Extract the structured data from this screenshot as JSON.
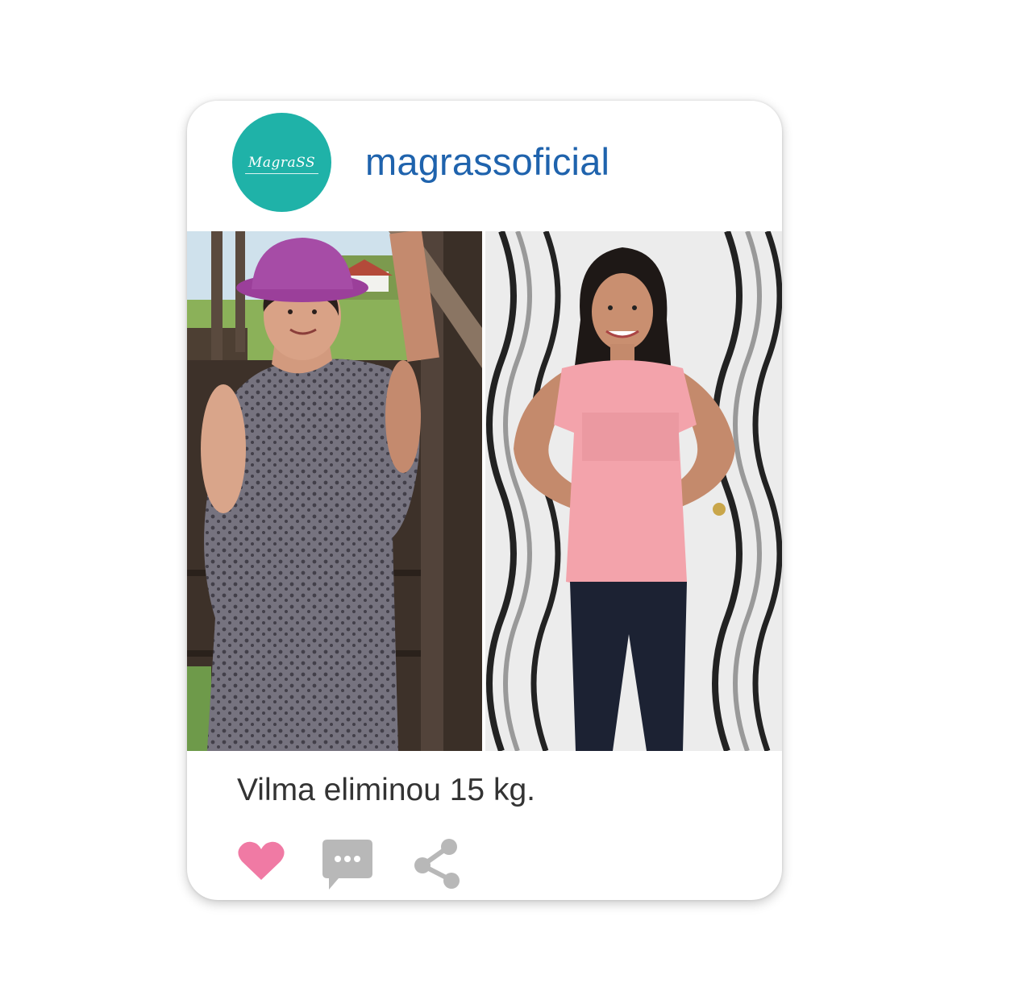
{
  "post": {
    "account": {
      "username": "magrassoficial",
      "avatar_logo": "MagraSS",
      "avatar_color": "#1fb2a8"
    },
    "images": [
      {
        "label": "before-photo"
      },
      {
        "label": "after-photo"
      }
    ],
    "caption": "Vilma eliminou 15 kg.",
    "actions": [
      {
        "name": "like",
        "icon": "heart-icon",
        "color": "#f07aa4"
      },
      {
        "name": "comment",
        "icon": "speech-bubble-icon",
        "color": "#b8b8b8"
      },
      {
        "name": "share",
        "icon": "share-icon",
        "color": "#b8b8b8"
      }
    ],
    "colors": {
      "username": "#1f63ad",
      "caption": "#333333"
    }
  }
}
